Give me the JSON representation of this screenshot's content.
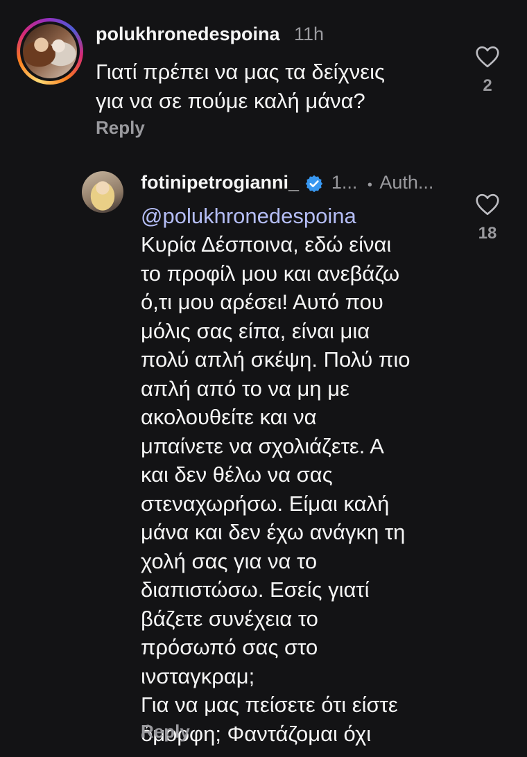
{
  "comments": [
    {
      "username": "polukhronedespoina",
      "time": "11h",
      "text": "Γιατί πρέπει να μας τα δείχνεις\nγια να σε πούμε καλή μάνα?",
      "reply_label": "Reply",
      "like_count": "2",
      "avatar_icon": "profile-photo"
    },
    {
      "username": "fotinipetrogianni_",
      "time": "1...",
      "separator": "•",
      "author_badge": "Auth...",
      "mention": "@polukhronedespoina",
      "text": "Κυρία Δέσποινα, εδώ είναι\nτο προφίλ μου και ανεβάζω\nό,τι μου αρέσει! Αυτό που\nμόλις σας είπα, είναι μια\nπολύ απλή σκέψη. Πολύ πιο\nαπλή από το να μη με\nακολουθείτε και να\nμπαίνετε να σχολιάζετε. Α\nκαι δεν θέλω να σας\nστεναχωρήσω. Είμαι καλή\nμάνα και δεν έχω ανάγκη τη\nχολή σας για να το\nδιαπιστώσω. Εσείς γιατί\nβάζετε συνέχεια το\nπρόσωπό σας στο\nινσταγκραμ;\nΓια να μας πείσετε ότι είστε\nόμορφη; Φαντάζομαι όχι",
      "reply_label": "Reply",
      "like_count": "18",
      "verified_icon": "verified-badge-icon"
    }
  ],
  "colors": {
    "background": "#131315",
    "text": "#f5f5f5",
    "secondary": "#9a9a9e",
    "mention": "#b4bdf5",
    "verified": "#3897f0"
  }
}
